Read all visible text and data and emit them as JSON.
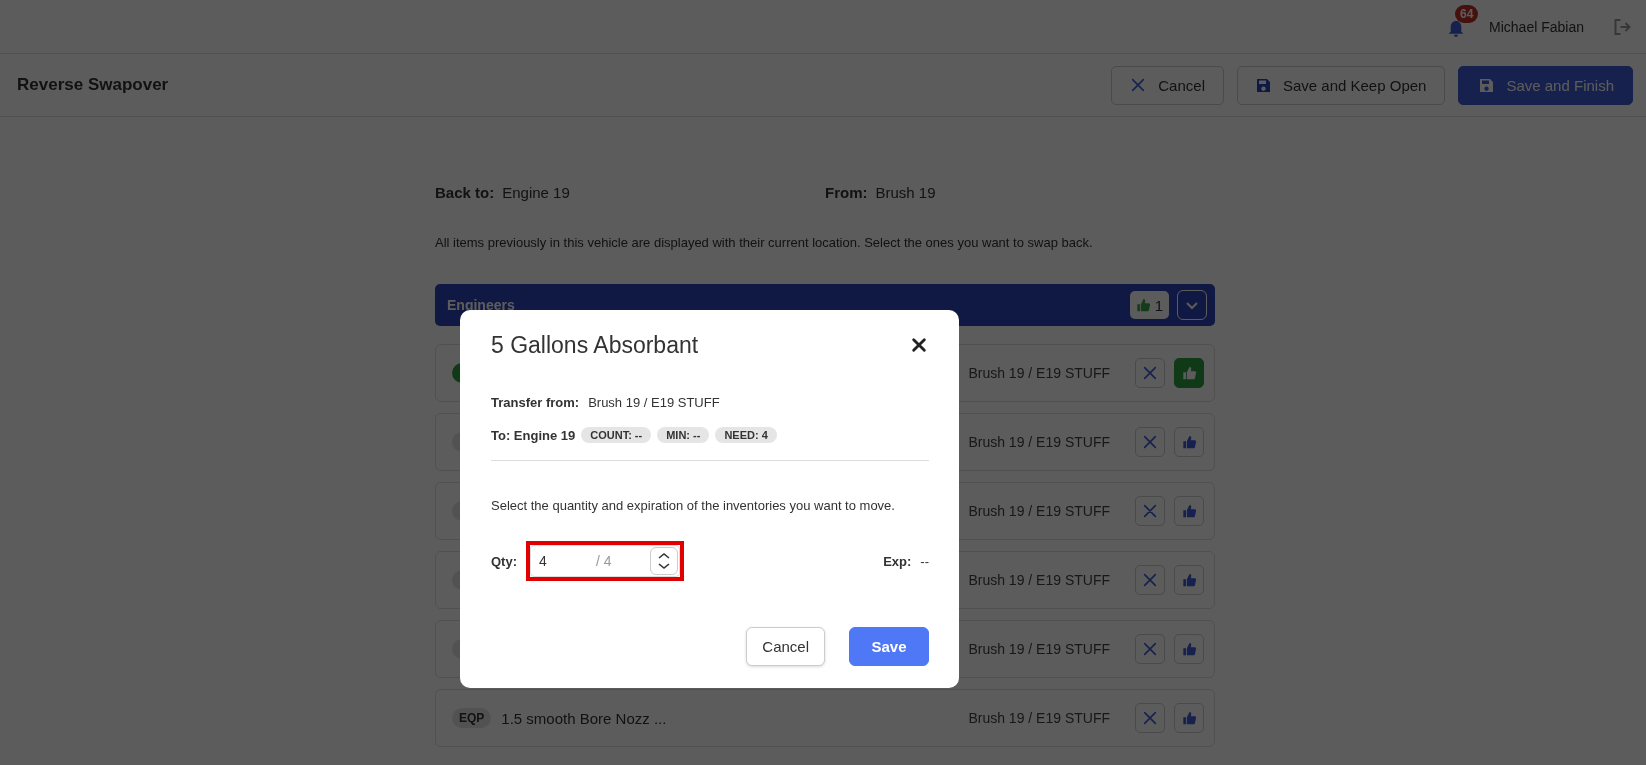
{
  "top_bar": {
    "notifications": {
      "count": "64"
    },
    "user": "Michael Fabian"
  },
  "header": {
    "title": "Reverse Swapover",
    "buttons": [
      {
        "kind": "cancel",
        "label": "Cancel"
      },
      {
        "kind": "save",
        "label": "Save and Keep Open"
      },
      {
        "kind": "primary",
        "label": "Save and Finish"
      }
    ]
  },
  "summary": {
    "back_to": {
      "label": "Back to:",
      "value": "Engine 19"
    },
    "from": {
      "label": "From:",
      "value": "Brush 19"
    }
  },
  "description": "All items previously in this vehicle are displayed with their current location. Select the ones you want to swap back.",
  "group": {
    "title": "Engineers",
    "approved_count": "1",
    "expanded": true
  },
  "rows": [
    {
      "location": "Brush 19 / E19 STUFF",
      "approved": true
    },
    {
      "location": "Brush 19 / E19 STUFF",
      "approved": false
    },
    {
      "location": "Brush 19 / E19 STUFF",
      "approved": false
    },
    {
      "location": "Brush 19 / E19 STUFF",
      "approved": false
    },
    {
      "location": "Brush 19 / E19 STUFF",
      "approved": false
    },
    {
      "tag": "EQP",
      "name": "1.5 smooth Bore Nozz ...",
      "location": "Brush 19 / E19 STUFF",
      "approved": false
    }
  ],
  "dialog": {
    "title": "5 Gallons Absorbant",
    "transfer_from": {
      "label": "Transfer from:",
      "value": "Brush 19 / E19 STUFF"
    },
    "to": "To: Engine 19",
    "chips": [
      "COUNT: --",
      "MIN: --",
      "NEED: 4"
    ],
    "instructions": "Select the quantity and expiration of the inventories you want to move.",
    "qty": {
      "label": "Qty:",
      "value": "4",
      "max": "/ 4",
      "highlighted": true
    },
    "exp": {
      "label": "Exp:",
      "value": "--"
    },
    "buttons": [
      {
        "kind": "cancel",
        "label": "Cancel"
      },
      {
        "kind": "primary",
        "label": "Save"
      }
    ]
  }
}
